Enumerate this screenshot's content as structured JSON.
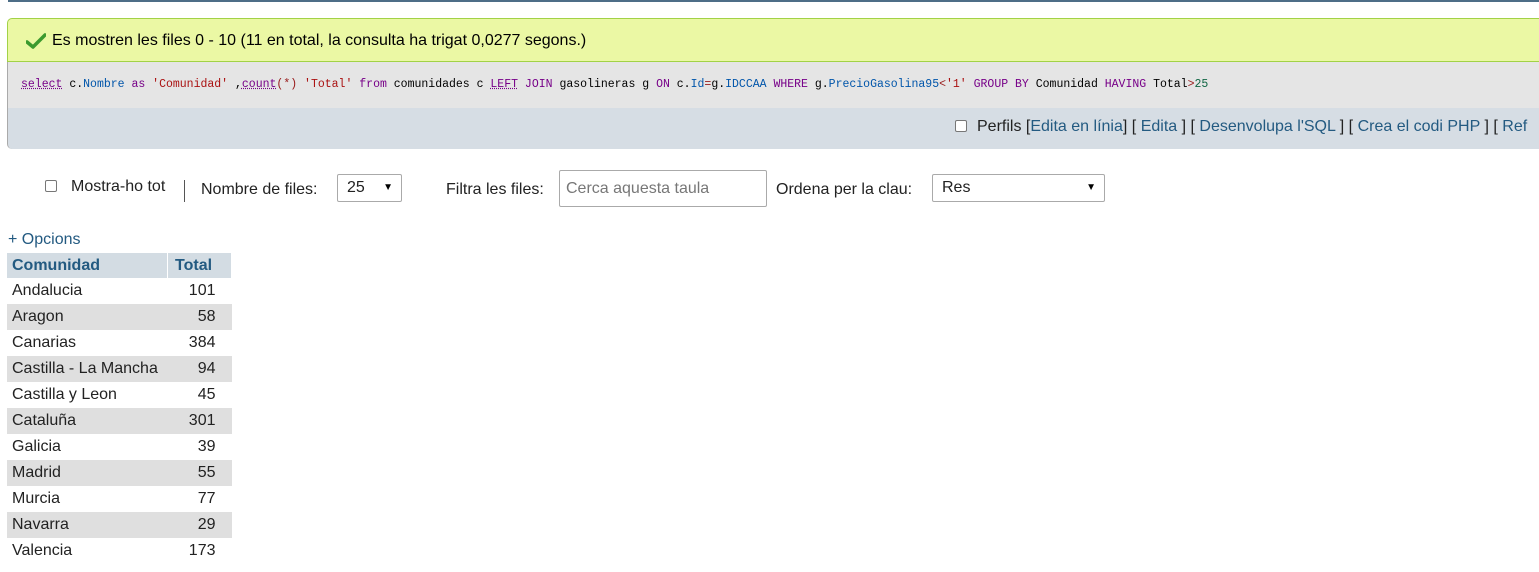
{
  "success": {
    "message": "Es mostren les files 0 - 10 (11 en total, la consulta ha trigat 0,0277 segons.)"
  },
  "sql": {
    "parts": [
      {
        "t": "select",
        "c": "sql-kwu"
      },
      {
        "t": " c.",
        "c": "sql-plain"
      },
      {
        "t": "Nombre",
        "c": "sql-var"
      },
      {
        "t": " as ",
        "c": "sql-kw"
      },
      {
        "t": "'Comunidad'",
        "c": "sql-str"
      },
      {
        "t": " ,",
        "c": "sql-plain"
      },
      {
        "t": "count",
        "c": "sql-fn"
      },
      {
        "t": "(*)",
        "c": "sql-op"
      },
      {
        "t": " ",
        "c": "sql-plain"
      },
      {
        "t": "'Total'",
        "c": "sql-str"
      },
      {
        "t": " from ",
        "c": "sql-kw"
      },
      {
        "t": "comunidades c ",
        "c": "sql-plain"
      },
      {
        "t": "LEFT",
        "c": "sql-kwu"
      },
      {
        "t": " JOIN ",
        "c": "sql-kw"
      },
      {
        "t": "gasolineras g ",
        "c": "sql-plain"
      },
      {
        "t": "ON",
        "c": "sql-kw"
      },
      {
        "t": " c.",
        "c": "sql-plain"
      },
      {
        "t": "Id",
        "c": "sql-var"
      },
      {
        "t": "=",
        "c": "sql-op"
      },
      {
        "t": "g.",
        "c": "sql-plain"
      },
      {
        "t": "IDCCAA",
        "c": "sql-var"
      },
      {
        "t": " WHERE ",
        "c": "sql-kw"
      },
      {
        "t": "g.",
        "c": "sql-plain"
      },
      {
        "t": "PrecioGasolina95",
        "c": "sql-var"
      },
      {
        "t": "<",
        "c": "sql-op"
      },
      {
        "t": "'1'",
        "c": "sql-str"
      },
      {
        "t": " GROUP BY ",
        "c": "sql-kw"
      },
      {
        "t": "Comunidad ",
        "c": "sql-plain"
      },
      {
        "t": "HAVING ",
        "c": "sql-kw"
      },
      {
        "t": "Total",
        "c": "sql-plain"
      },
      {
        "t": ">",
        "c": "sql-op"
      },
      {
        "t": "25",
        "c": "sql-num"
      }
    ]
  },
  "tools": {
    "profiling_label": "Perfils",
    "bracket_open": "[",
    "bracket_close": "]",
    "edit_inline": "Edita en línia",
    "edit": "Edita",
    "explain": "Desenvolupa l'SQL",
    "create_php": "Crea el codi PHP",
    "refresh": "Ref"
  },
  "nav": {
    "show_all_label": "Mostra-ho tot",
    "rows_label": "Nombre de files:",
    "rows_value": "25",
    "filter_label": "Filtra les files:",
    "filter_placeholder": "Cerca aquesta taula",
    "sort_label": "Ordena per la clau:",
    "sort_value": "Res"
  },
  "options_link": "+ Opcions",
  "table": {
    "headers": [
      "Comunidad",
      "Total"
    ],
    "rows": [
      [
        "Andalucia",
        "101"
      ],
      [
        "Aragon",
        "58"
      ],
      [
        "Canarias",
        "384"
      ],
      [
        "Castilla - La Mancha",
        "94"
      ],
      [
        "Castilla y Leon",
        "45"
      ],
      [
        "Cataluña",
        "301"
      ],
      [
        "Galicia",
        "39"
      ],
      [
        "Madrid",
        "55"
      ],
      [
        "Murcia",
        "77"
      ],
      [
        "Navarra",
        "29"
      ],
      [
        "Valencia",
        "173"
      ]
    ]
  },
  "colors": {
    "success_bg": "#ebf8a4",
    "link": "#235a81",
    "header_bg": "#d3dce3",
    "even_row_bg": "#dfdfdf"
  }
}
